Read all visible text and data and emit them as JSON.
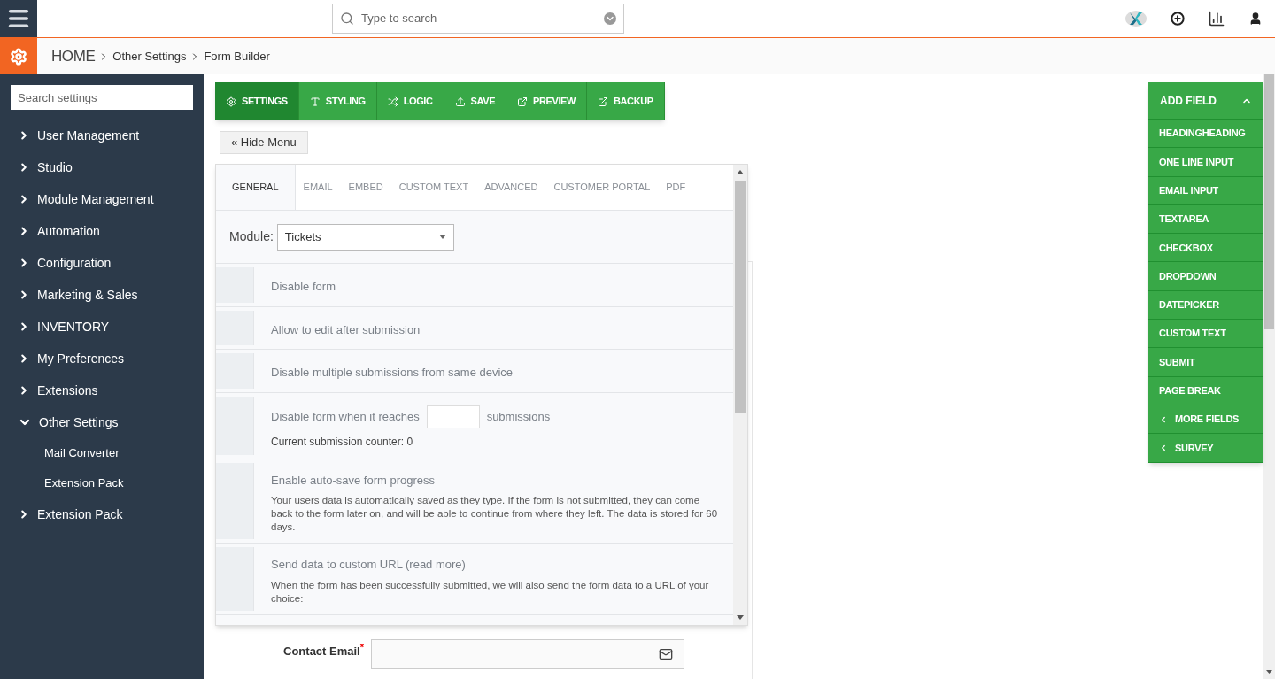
{
  "topbar": {
    "search": {
      "placeholder": "Type to search"
    }
  },
  "breadcrumb": [
    "HOME",
    "Other Settings",
    "Form Builder"
  ],
  "sidebar": {
    "search": {
      "placeholder": "Search settings"
    },
    "items": [
      {
        "label": "User Management",
        "expanded": false
      },
      {
        "label": "Studio",
        "expanded": false
      },
      {
        "label": "Module Management",
        "expanded": false
      },
      {
        "label": "Automation",
        "expanded": false
      },
      {
        "label": "Configuration",
        "expanded": false
      },
      {
        "label": "Marketing & Sales",
        "expanded": false
      },
      {
        "label": "INVENTORY",
        "expanded": false
      },
      {
        "label": "My Preferences",
        "expanded": false
      },
      {
        "label": "Extensions",
        "expanded": false
      },
      {
        "label": "Other Settings",
        "expanded": true,
        "children": [
          {
            "label": "Mail Converter"
          },
          {
            "label": "Extension Pack"
          }
        ]
      },
      {
        "label": "Extension Pack",
        "expanded": false
      }
    ]
  },
  "toolbar": [
    {
      "label": "SETTINGS",
      "selected": true
    },
    {
      "label": "STYLING",
      "selected": false
    },
    {
      "label": "LOGIC",
      "selected": false
    },
    {
      "label": "SAVE",
      "selected": false
    },
    {
      "label": "PREVIEW",
      "selected": false
    },
    {
      "label": "BACKUP",
      "selected": false
    }
  ],
  "hide_menu": "« Hide Menu",
  "settings_panel": {
    "tabs": [
      {
        "label": "GENERAL",
        "selected": true
      },
      {
        "label": "EMAIL",
        "selected": false
      },
      {
        "label": "EMBED",
        "selected": false
      },
      {
        "label": "CUSTOM TEXT",
        "selected": false
      },
      {
        "label": "ADVANCED",
        "selected": false
      },
      {
        "label": "CUSTOMER PORTAL",
        "selected": false
      },
      {
        "label": "PDF",
        "selected": false
      }
    ],
    "module": {
      "label": "Module:",
      "value": "Tickets"
    },
    "options": [
      {
        "kind": "plain",
        "label": "Disable form"
      },
      {
        "kind": "plain",
        "label": "Allow to edit after submission"
      },
      {
        "kind": "plain",
        "label": "Disable multiple submissions from same device"
      },
      {
        "kind": "limit",
        "label": "Disable form when it reaches",
        "suffix": "submissions",
        "note": "Current submission counter: 0"
      },
      {
        "kind": "described",
        "label": "Enable auto-save form progress",
        "description": "Your users data is automatically saved as they type. If the form is not submitted, they can come back to the form later on, and will be able to continue from where they left. The data is stored for 60 days."
      },
      {
        "kind": "described",
        "label": "Send data to custom URL (read more)",
        "description": "When the form has been successfully submitted, we will also send the form data to a URL of your choice:"
      }
    ]
  },
  "form": {
    "fields": [
      {
        "label": "Contact Email",
        "required_mark": "*"
      }
    ]
  },
  "add_field": {
    "title": "ADD FIELD",
    "items": [
      {
        "kind": "field",
        "label": "HEADINGHEADING"
      },
      {
        "kind": "field",
        "label": "ONE LINE INPUT"
      },
      {
        "kind": "field",
        "label": "EMAIL INPUT"
      },
      {
        "kind": "field",
        "label": "TEXTAREA"
      },
      {
        "kind": "field",
        "label": "CHECKBOX"
      },
      {
        "kind": "field",
        "label": "DROPDOWN"
      },
      {
        "kind": "field",
        "label": "DATEPICKER"
      },
      {
        "kind": "field",
        "label": "CUSTOM TEXT"
      },
      {
        "kind": "field",
        "label": "SUBMIT"
      },
      {
        "kind": "field",
        "label": "PAGE BREAK"
      },
      {
        "kind": "group",
        "label": "MORE FIELDS"
      },
      {
        "kind": "group",
        "label": "SURVEY"
      }
    ]
  }
}
